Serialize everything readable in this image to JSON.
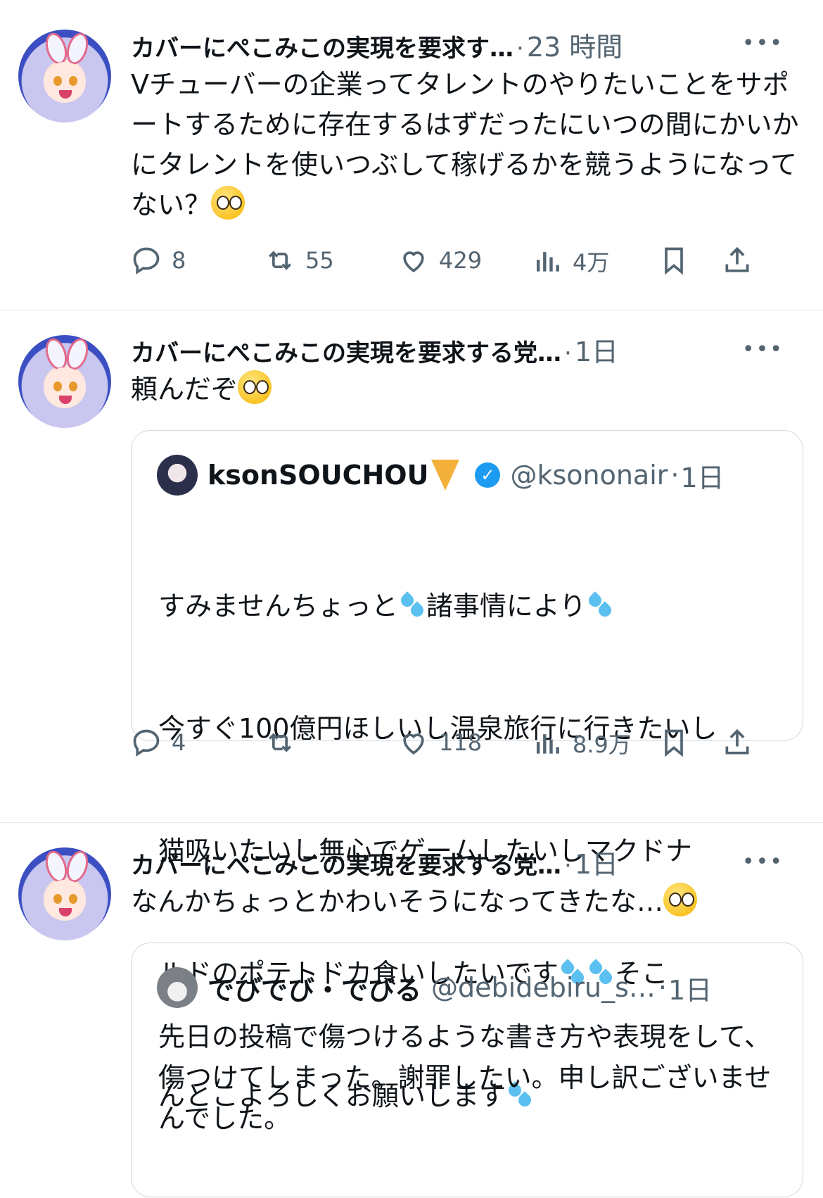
{
  "tweets": [
    {
      "author": "カバーにぺこみこの実現を要求す…",
      "time": "23 時間",
      "more": "•••",
      "text": "Vチューバーの企業ってタレントのやりたいことをサポートするために存在するはずだったにいつの間にかいかにタレントを使いつぶして稼げるかを競うようになってない？",
      "emoji": "pleading-face",
      "actions": {
        "replies": "8",
        "retweets": "55",
        "likes": "429",
        "views": "4万"
      }
    },
    {
      "author": "カバーにぺこみこの実現を要求する党…",
      "time": "1日",
      "more": "•••",
      "text": "頼んだぞ",
      "emoji": "pleading-face",
      "quote": {
        "name": "ksonSOUCHOU",
        "name_emoji": "pizza",
        "verified": true,
        "handle": "@ksononair",
        "time": "1日",
        "lines": [
          "すみませんちょっと",
          "諸事情により",
          "今すぐ100億円ほしいし温泉旅行に行きたいし",
          "猫吸いたいし無心でゲームしたいしマクドナ",
          "ルドのポテトドカ食いしたいです",
          "そこ",
          "んとこよろしくお願いします"
        ],
        "emoji": "sweat-droplets"
      },
      "actions": {
        "replies": "4",
        "retweets": "",
        "likes": "118",
        "views": "8.9万"
      }
    },
    {
      "author": "カバーにぺこみこの実現を要求する党…",
      "time": "1日",
      "more": "•••",
      "text": "なんかちょっとかわいそうになってきたな…",
      "emoji": "pleading-face",
      "quote": {
        "name": "でびでび・でびる",
        "handle": "@debidebiru_s…",
        "time": "1日",
        "text": "先日の投稿で傷つけるような書き方や表現をして、傷つけてしまった。謝罪したい。申し訳ございませんでした。"
      }
    }
  ],
  "colors": {
    "accent": "#1d9bf0",
    "muted": "#536471",
    "border": "#cfd9de",
    "divider": "#e7e9ea"
  }
}
